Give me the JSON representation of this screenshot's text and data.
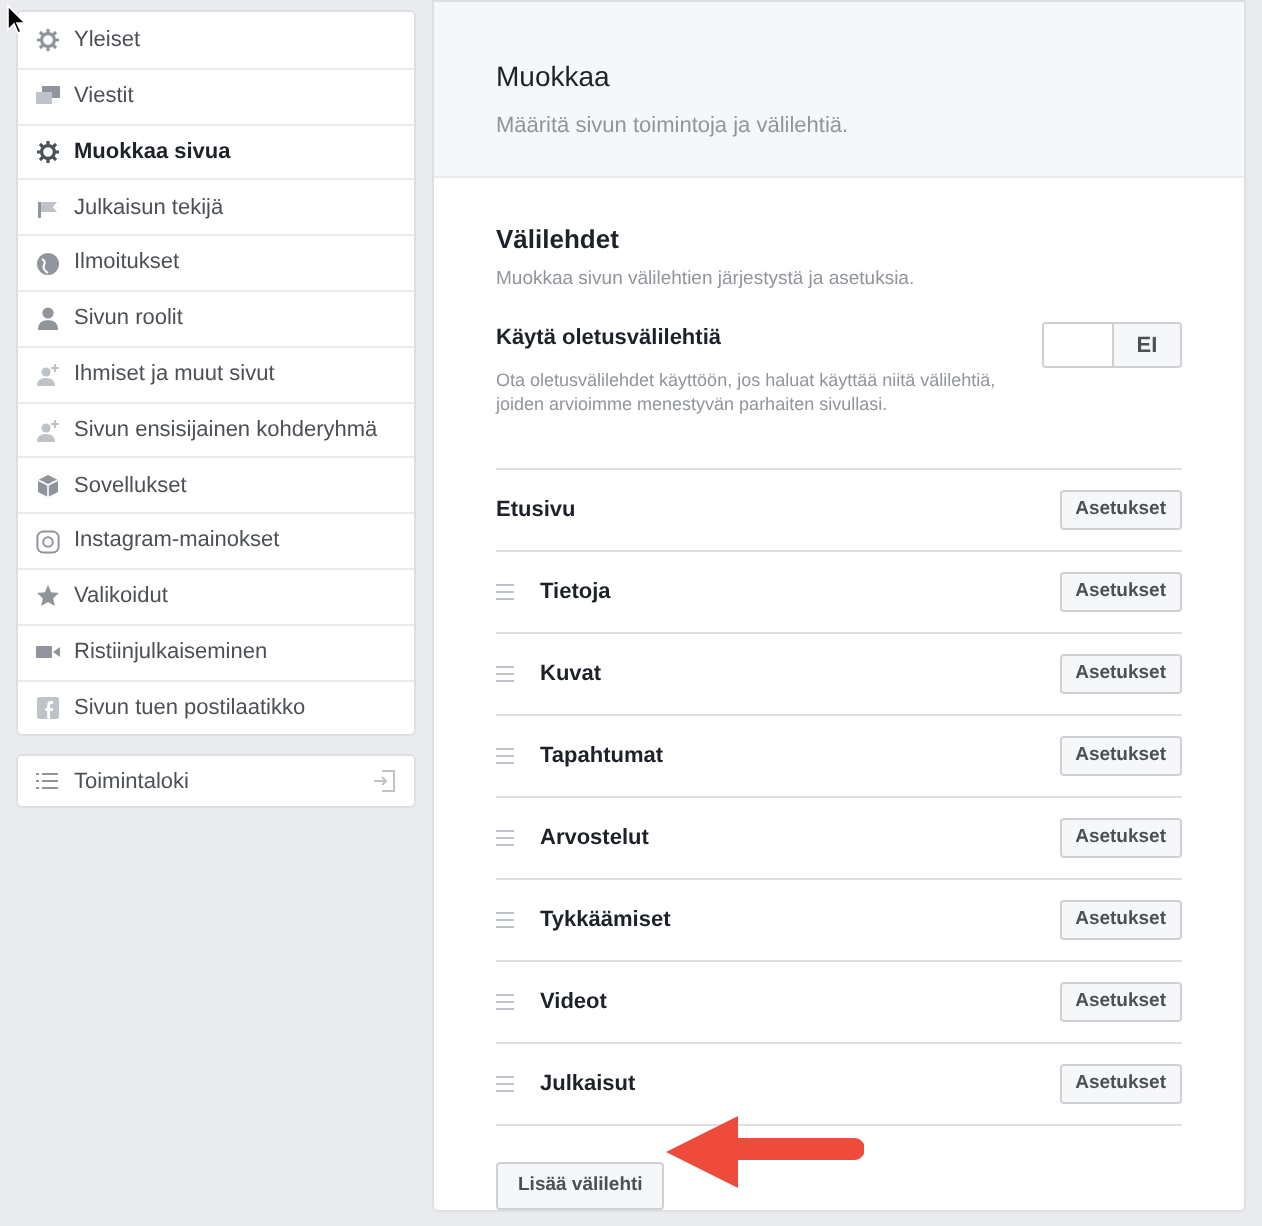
{
  "sidebar": {
    "items": [
      {
        "label": "Yleiset",
        "selected": false
      },
      {
        "label": "Viestit",
        "selected": false
      },
      {
        "label": "Muokkaa sivua",
        "selected": true
      },
      {
        "label": "Julkaisun tekijä",
        "selected": false
      },
      {
        "label": "Ilmoitukset",
        "selected": false
      },
      {
        "label": "Sivun roolit",
        "selected": false
      },
      {
        "label": "Ihmiset ja muut sivut",
        "selected": false
      },
      {
        "label": "Sivun ensisijainen kohderyhmä",
        "selected": false
      },
      {
        "label": "Sovellukset",
        "selected": false
      },
      {
        "label": "Instagram-mainokset",
        "selected": false
      },
      {
        "label": "Valikoidut",
        "selected": false
      },
      {
        "label": "Ristiinjulkaiseminen",
        "selected": false
      },
      {
        "label": "Sivun tuen postilaatikko",
        "selected": false
      }
    ],
    "activity_log": {
      "label": "Toimintaloki"
    }
  },
  "header": {
    "title": "Muokkaa",
    "subtitle": "Määritä sivun toimintoja ja välilehtiä."
  },
  "tabs_section": {
    "title": "Välilehdet",
    "description": "Muokkaa sivun välilehtien järjestystä ja asetuksia.",
    "default_tabs": {
      "label": "Käytä oletusvälilehtiä",
      "description": "Ota oletusvälilehdet käyttöön, jos haluat käyttää niitä välilehtiä, joiden arvioimme menestyvän parhaiten sivullasi.",
      "on": false,
      "toggle_text": "EI"
    },
    "tabs": [
      {
        "name": "Etusivu",
        "kind": "fixed",
        "button": "Asetukset"
      },
      {
        "name": "Tietoja",
        "kind": "draggable",
        "button": "Asetukset"
      },
      {
        "name": "Kuvat",
        "kind": "draggable",
        "button": "Asetukset"
      },
      {
        "name": "Tapahtumat",
        "kind": "draggable",
        "button": "Asetukset"
      },
      {
        "name": "Arvostelut",
        "kind": "draggable",
        "button": "Asetukset"
      },
      {
        "name": "Tykkäämiset",
        "kind": "draggable",
        "button": "Asetukset"
      },
      {
        "name": "Videot",
        "kind": "draggable",
        "button": "Asetukset"
      },
      {
        "name": "Julkaisut",
        "kind": "draggable",
        "button": "Asetukset"
      }
    ],
    "add_button": "Lisää välilehti"
  }
}
